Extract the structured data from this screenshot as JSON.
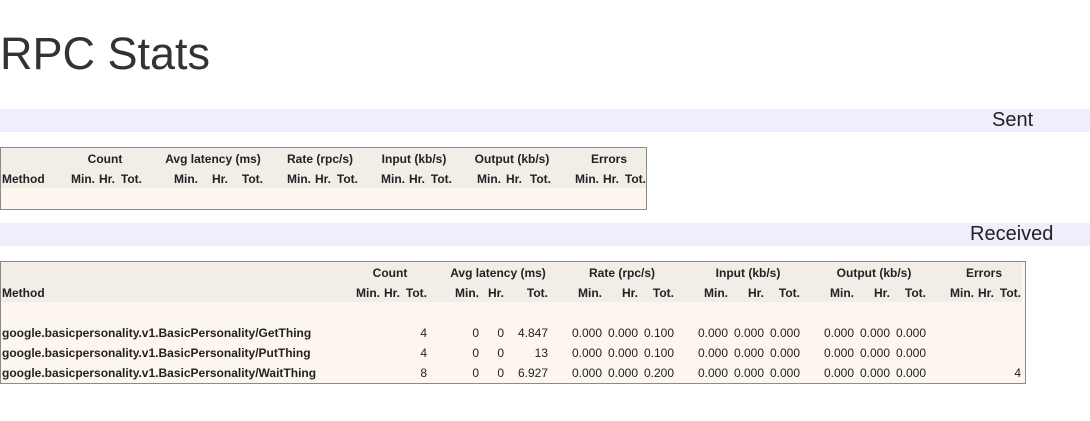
{
  "title": "RPC Stats",
  "sections": {
    "sent": {
      "label": "Sent"
    },
    "received": {
      "label": "Received"
    }
  },
  "headers": {
    "method": "Method",
    "count": "Count",
    "avg_latency": "Avg latency (ms)",
    "rate": "Rate (rpc/s)",
    "input": "Input (kb/s)",
    "output": "Output (kb/s)",
    "errors": "Errors",
    "min": "Min.",
    "hr": "Hr.",
    "tot": "Tot."
  },
  "received_rows": [
    {
      "method": "google.basicpersonality.v1.BasicPersonality/GetThing",
      "count_tot": "4",
      "lat_min": "0",
      "lat_hr": "0",
      "lat_tot": "4.847",
      "rate_min": "0.000",
      "rate_hr": "0.000",
      "rate_tot": "0.100",
      "in_min": "0.000",
      "in_hr": "0.000",
      "in_tot": "0.000",
      "out_min": "0.000",
      "out_hr": "0.000",
      "out_tot": "0.000",
      "err_tot": ""
    },
    {
      "method": "google.basicpersonality.v1.BasicPersonality/PutThing",
      "count_tot": "4",
      "lat_min": "0",
      "lat_hr": "0",
      "lat_tot": "13",
      "rate_min": "0.000",
      "rate_hr": "0.000",
      "rate_tot": "0.100",
      "in_min": "0.000",
      "in_hr": "0.000",
      "in_tot": "0.000",
      "out_min": "0.000",
      "out_hr": "0.000",
      "out_tot": "0.000",
      "err_tot": ""
    },
    {
      "method": "google.basicpersonality.v1.BasicPersonality/WaitThing",
      "count_tot": "8",
      "lat_min": "0",
      "lat_hr": "0",
      "lat_tot": "6.927",
      "rate_min": "0.000",
      "rate_hr": "0.000",
      "rate_tot": "0.200",
      "in_min": "0.000",
      "in_hr": "0.000",
      "in_tot": "0.000",
      "out_min": "0.000",
      "out_hr": "0.000",
      "out_tot": "0.000",
      "err_tot": "4"
    }
  ]
}
